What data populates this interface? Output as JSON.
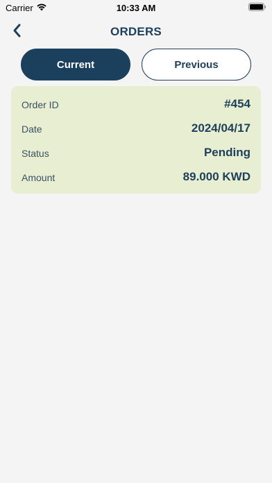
{
  "status_bar": {
    "carrier": "Carrier",
    "time": "10:33 AM"
  },
  "header": {
    "title": "ORDERS",
    "back_icon": "chevron-left-icon"
  },
  "tabs": [
    {
      "label": "Current",
      "selected": true
    },
    {
      "label": "Previous",
      "selected": false
    }
  ],
  "order": {
    "rows": [
      {
        "label": "Order ID",
        "value": "#454"
      },
      {
        "label": "Date",
        "value": "2024/04/17"
      },
      {
        "label": "Status",
        "value": "Pending"
      },
      {
        "label": "Amount",
        "value": "89.000 KWD"
      }
    ]
  },
  "colors": {
    "primary": "#1a405e",
    "card": "#e8eed1",
    "background": "#f4f4f5"
  }
}
